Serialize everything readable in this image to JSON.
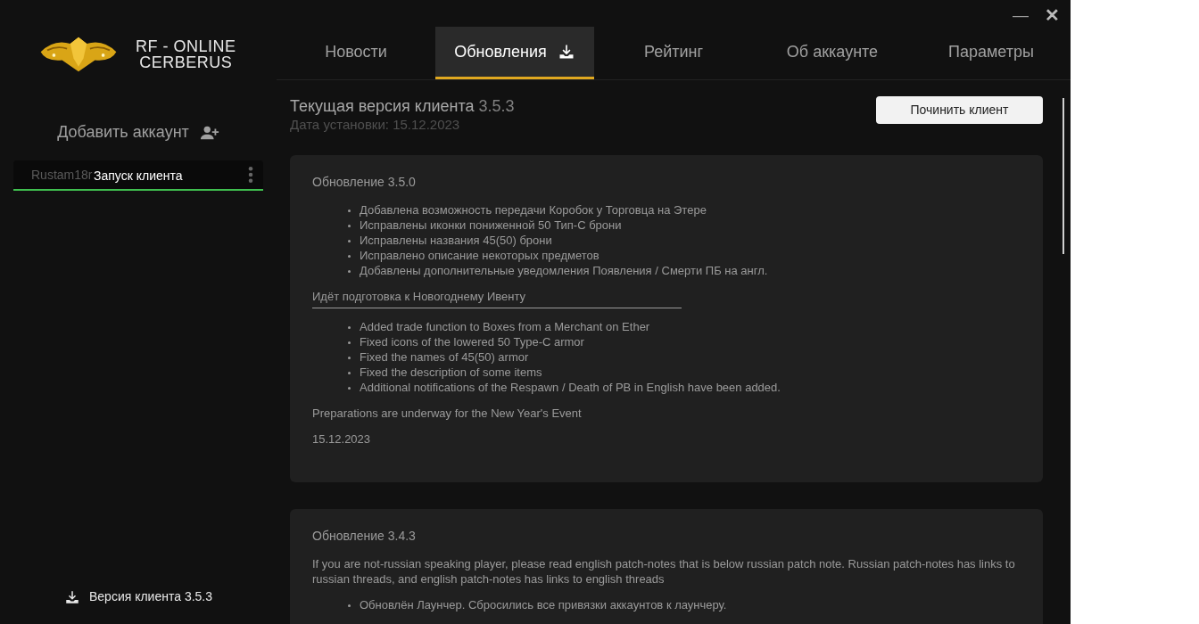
{
  "logo": {
    "line1": "RF - ONLINE",
    "line2": "CERBERUS"
  },
  "window_controls": {
    "minimize": "—",
    "close": "✕"
  },
  "tabs": [
    {
      "label": "Новости",
      "selected": false,
      "kind": "plain"
    },
    {
      "label": "Обновления",
      "selected": true,
      "kind": "download"
    },
    {
      "label": "Рейтинг",
      "selected": false,
      "kind": "plain"
    },
    {
      "label": "Об аккаунте",
      "selected": false,
      "kind": "plain"
    },
    {
      "label": "Параметры",
      "selected": false,
      "kind": "plain"
    }
  ],
  "sidebar": {
    "add_account": "Добавить аккаунт",
    "accounts": [
      {
        "name": "Rustam18r",
        "selected": true,
        "tooltip": "Запуск клиента"
      }
    ],
    "client_version": "Версия клиента 3.5.3"
  },
  "current": {
    "label": "Текущая версия клиента",
    "version": "3.5.3",
    "install_date": "Дата установки: 15.12.2023",
    "repair_button": "Починить клиент"
  },
  "updates": [
    {
      "title": "Обновление 3.5.0",
      "blocks": [
        {
          "kind": "list",
          "items": [
            "Добавлена возможность передачи Коробок у Торговца на Этере",
            "Исправлены иконки пониженной 50 Тип-С брони",
            "Исправлены названия 45(50) брони",
            "Исправлено описание некоторых предметов",
            "Добавлены дополнительные уведомления Появления / Смерти ПБ на англ."
          ]
        },
        {
          "kind": "text",
          "text": "Идёт подготовка к Новогоднему Ивенту"
        },
        {
          "kind": "rule"
        },
        {
          "kind": "list",
          "items": [
            "Added trade function to Boxes from a Merchant on Ether",
            "Fixed icons of the lowered 50 Type-C armor",
            "Fixed the names of 45(50) armor",
            "Fixed the description of some items",
            "Additional notifications of the Respawn / Death of PB in English have been added."
          ]
        },
        {
          "kind": "text",
          "text": "Preparations are underway for the New Year's Event"
        },
        {
          "kind": "text",
          "text": "15.12.2023"
        }
      ]
    },
    {
      "title": "Обновление 3.4.3",
      "blocks": [
        {
          "kind": "text",
          "text": "If you are not-russian speaking player, please read english patch-notes that is below russian patch note. Russian patch-notes has links to russian threads, and english patch-notes has links to english threads"
        },
        {
          "kind": "list",
          "items": [
            "Обновлён Лаунчер. Сбросились все привязки аккаунтов к лаунчеру."
          ]
        }
      ]
    }
  ]
}
